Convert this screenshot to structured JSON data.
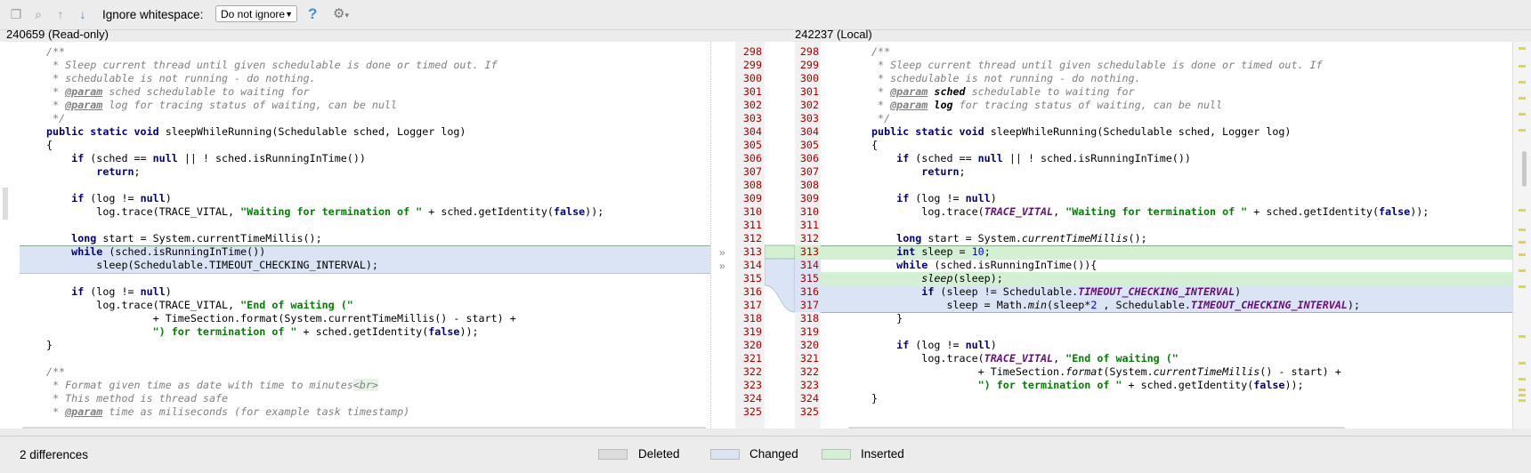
{
  "toolbar": {
    "ignore_whitespace_label": "Ignore whitespace:",
    "ignore_whitespace_value": "Do not ignore",
    "help_icon": "?",
    "gear_icon": "⚙",
    "gear_dropdown": "▾"
  },
  "left_title": "240659 (Read-only)",
  "right_title": "242237 (Local)",
  "left_line_numbers": [
    "298",
    "299",
    "300",
    "301",
    "302",
    "303",
    "304",
    "305",
    "306",
    "307",
    "308",
    "309",
    "310",
    "311",
    "312",
    "313",
    "314",
    "315",
    "316",
    "317",
    "318",
    "319",
    "320",
    "321",
    "322",
    "323",
    "324",
    "325"
  ],
  "right_line_numbers": [
    "298",
    "299",
    "300",
    "301",
    "302",
    "303",
    "304",
    "305",
    "306",
    "307",
    "308",
    "309",
    "310",
    "311",
    "312",
    "313",
    "314",
    "315",
    "316",
    "317",
    "318",
    "319",
    "320",
    "321",
    "322",
    "323",
    "324",
    "325"
  ],
  "status": {
    "differences": "2 differences",
    "legend_deleted": "Deleted",
    "legend_changed": "Changed",
    "legend_inserted": "Inserted"
  },
  "colors": {
    "deleted": "#dcdcdc",
    "changed": "#dbe4f5",
    "inserted": "#d3f0d3",
    "line_number": "#aa0000"
  }
}
